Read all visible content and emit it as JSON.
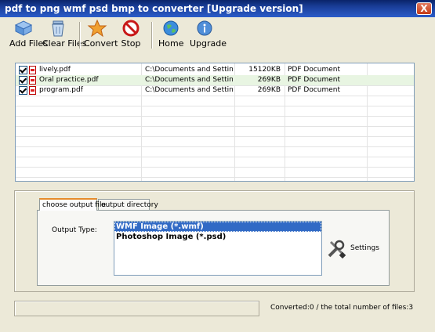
{
  "window": {
    "title": "pdf to png wmf psd bmp to converter [Upgrade version]",
    "close_glyph": "X"
  },
  "toolbar": {
    "add_files": "Add Files",
    "clear_files": "Clear Files",
    "convert": "Convert",
    "stop": "Stop",
    "home": "Home",
    "upgrade": "Upgrade"
  },
  "files": [
    {
      "name": "lively.pdf",
      "path": "C:\\Documents and Setting...",
      "size": "15120KB",
      "type": "PDF Document",
      "checked": true
    },
    {
      "name": "Oral practice.pdf",
      "path": "C:\\Documents and Setting...",
      "size": "269KB",
      "type": "PDF Document",
      "checked": true
    },
    {
      "name": "program.pdf",
      "path": "C:\\Documents and Setting...",
      "size": "269KB",
      "type": "PDF Document",
      "checked": true
    }
  ],
  "tabs": {
    "output_file": "choose output file",
    "output_directory": "output directory"
  },
  "output": {
    "type_label": "Output Type:",
    "options": [
      "WMF Image (*.wmf)",
      "Photoshop Image (*.psd)"
    ],
    "selected": "WMF Image (*.wmf)",
    "settings": "Settings"
  },
  "status": {
    "text": "Converted:0  /  the total number of files:3"
  },
  "colors": {
    "title_bar": "#0a246a",
    "selection": "#316ac5",
    "row_highlight": "#e8f5e2",
    "window_bg": "#ece9d8"
  }
}
